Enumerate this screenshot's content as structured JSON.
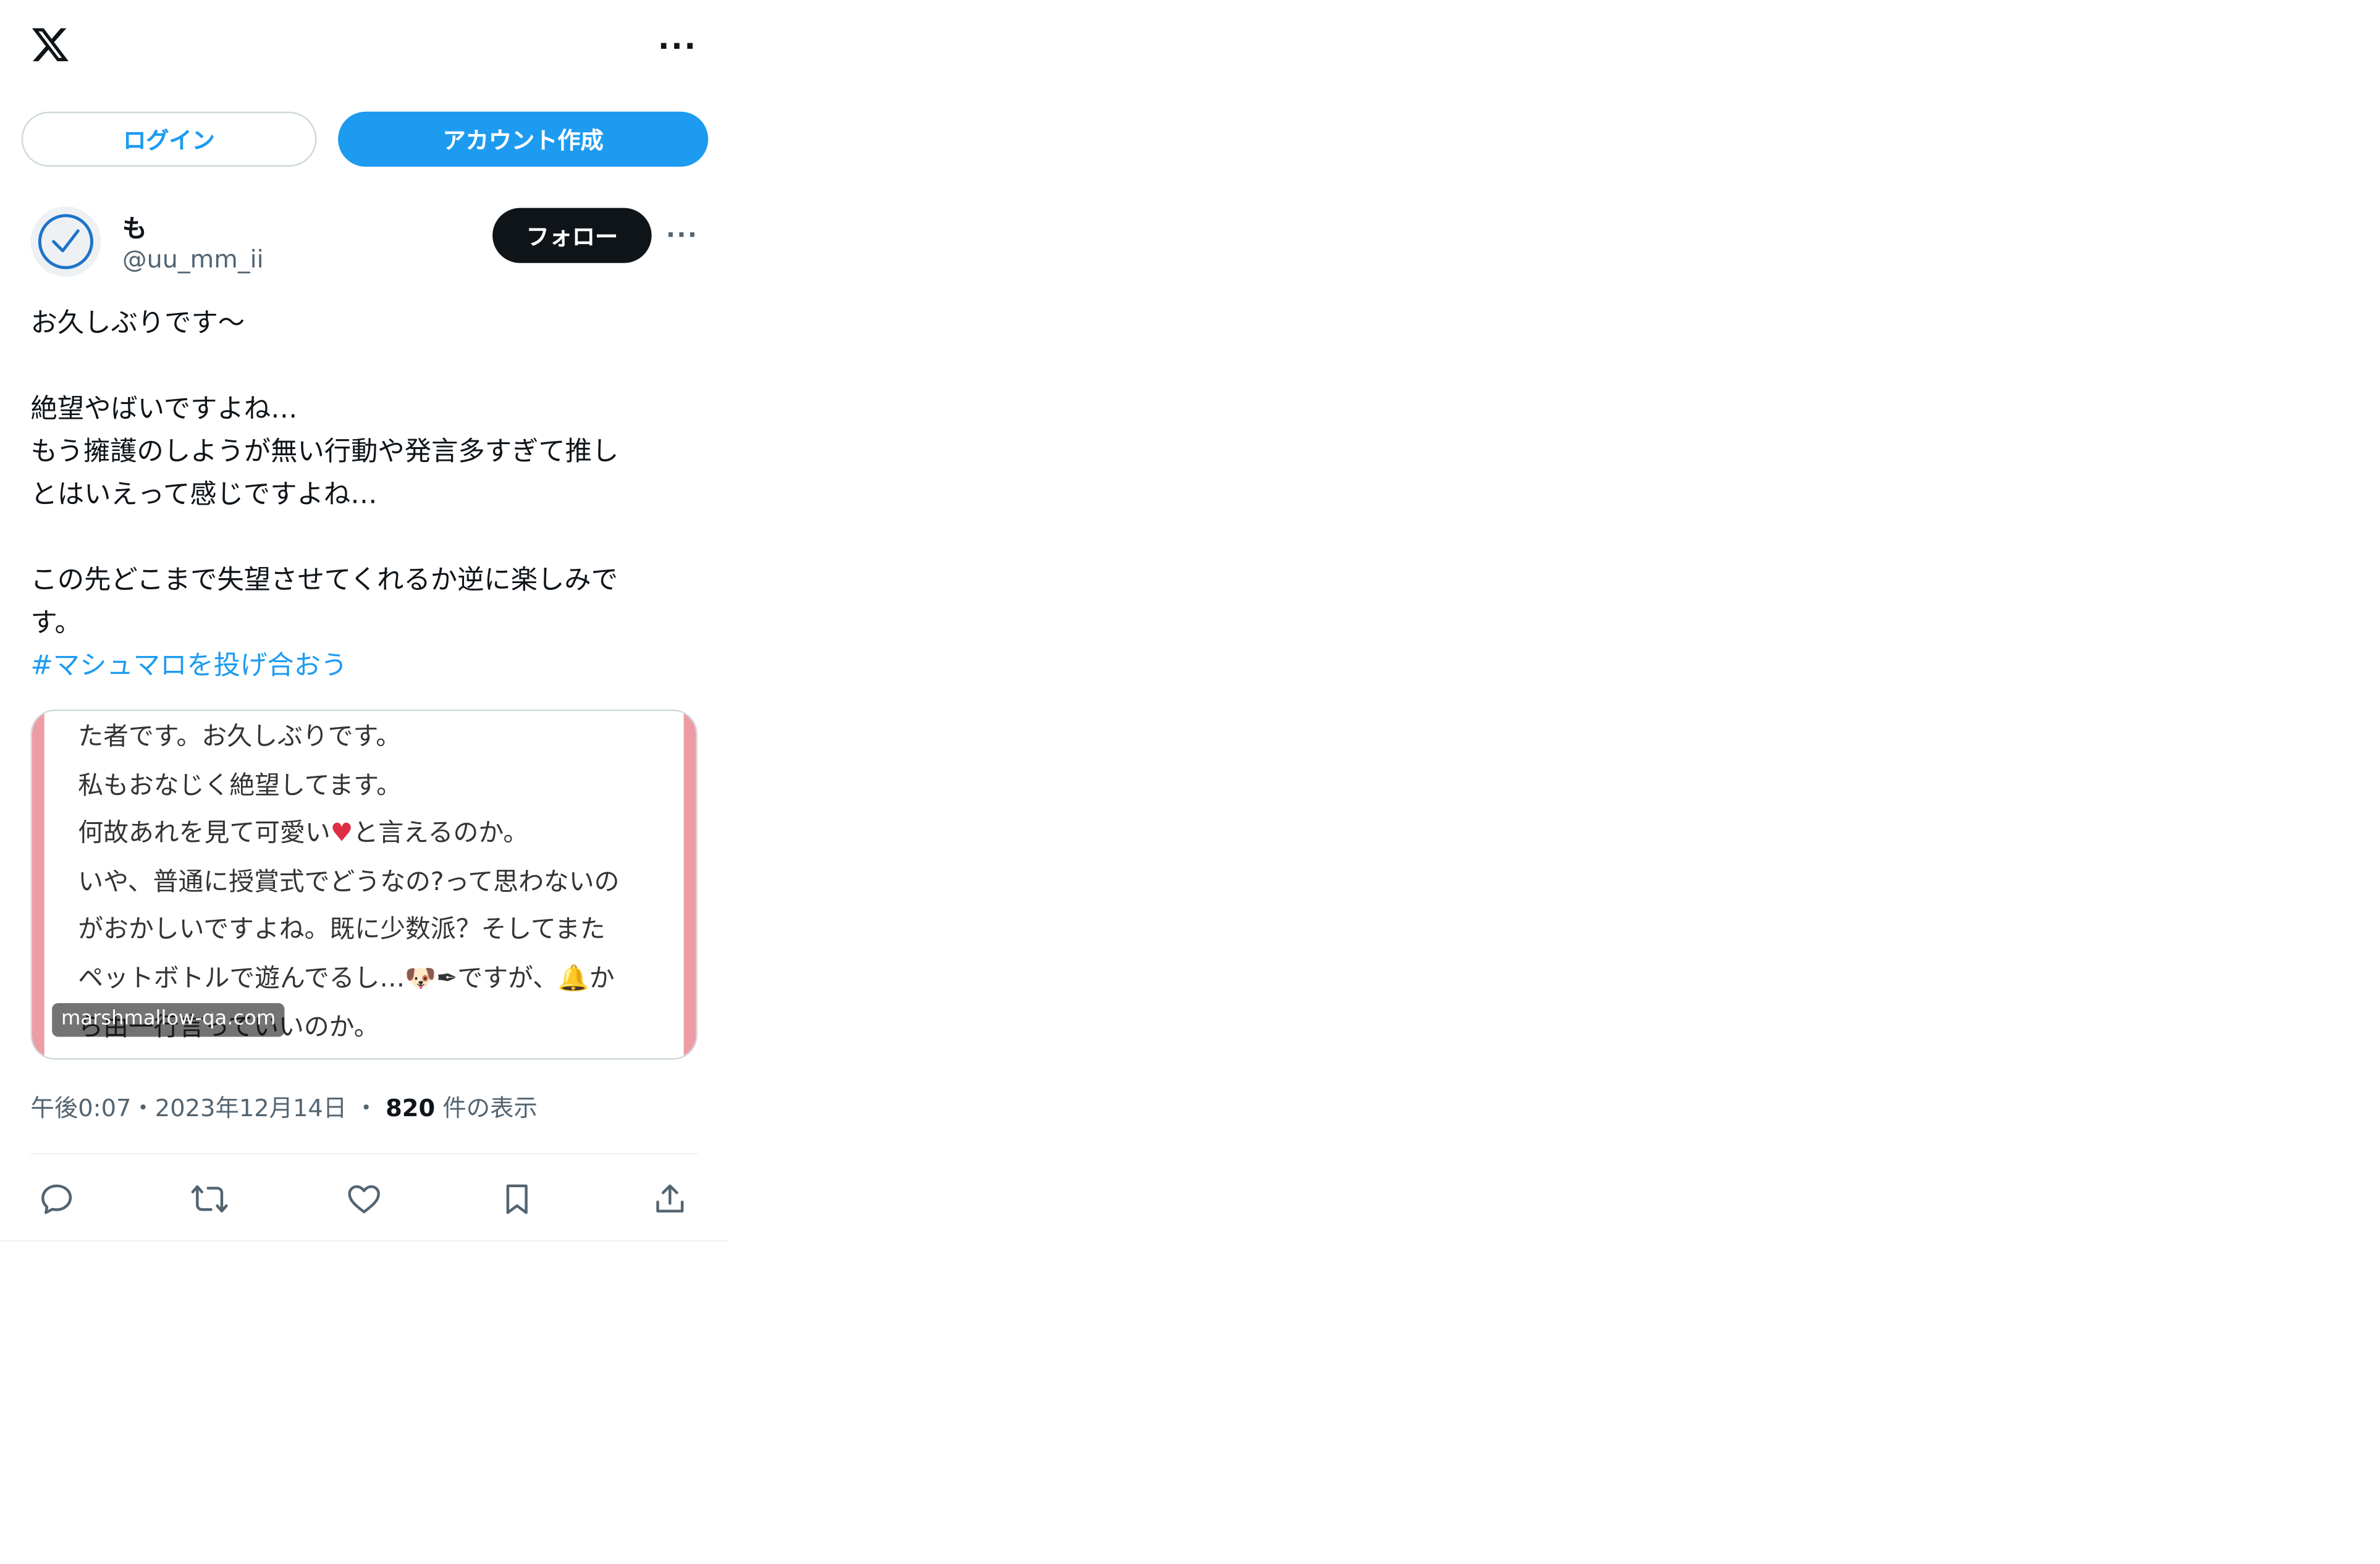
{
  "header": {
    "logo_icon": "x-logo-icon",
    "more_icon": "more-horizontal-icon",
    "more_label": "···"
  },
  "auth": {
    "login_label": "ログイン",
    "signup_label": "アカウント作成"
  },
  "tweet": {
    "author": {
      "name": "も",
      "handle": "@uu_mm_ii",
      "avatar_icon": "checkmark-circle-icon"
    },
    "follow_label": "フォロー",
    "more_label": "···",
    "text_lines": [
      "お久しぶりです〜",
      "",
      "絶望やばいですよね…",
      "もう擁護のしようが無い行動や発言多すぎて推し",
      "とはいえって感じですよね…",
      "",
      "この先どこまで失望させてくれるか逆に楽しみで",
      "す。"
    ],
    "hashtag": "#マシュマロを投げ合おう",
    "card": {
      "lines": {
        "l1": "た者です。お久しぶりです。",
        "l2": "私もおなじく絶望してます。",
        "l3a": "何故あれを見て可愛い",
        "l3_heart": "♥",
        "l3b": "と言えるのか。",
        "l4": "いや、普通に授賞式でどうなの?って思わないの",
        "l5": "がおかしいですよね。既に少数派？そしてまた",
        "l6a": "ペットボトルで遊んでるし…",
        "l6_dog": "🐶",
        "l6_pen": "✒",
        "l6b": "ですが、",
        "l6_bell": "🔔",
        "l6c": "か",
        "l7": "ら由一行言っていいのか。"
      },
      "domain": "marshmallow-qa.com",
      "accent_color": "#ee9ca3"
    },
    "timestamp": "午後0:07・2023年12月14日",
    "separator": "・",
    "views_count": "820",
    "views_label": "件の表示",
    "actions": [
      {
        "name": "reply",
        "icon": "reply-icon"
      },
      {
        "name": "retweet",
        "icon": "retweet-icon"
      },
      {
        "name": "like",
        "icon": "heart-icon"
      },
      {
        "name": "bookmark",
        "icon": "bookmark-icon"
      },
      {
        "name": "share",
        "icon": "share-icon"
      }
    ]
  },
  "colors": {
    "brand_blue": "#1d9bf0",
    "text_primary": "#0f1419",
    "text_secondary": "#536471",
    "border": "#cfd9de"
  }
}
